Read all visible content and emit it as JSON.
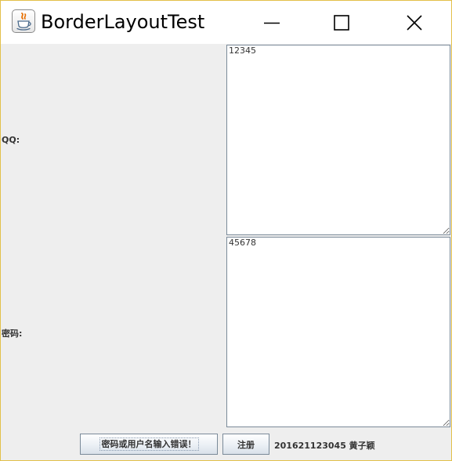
{
  "window": {
    "title": "BorderLayoutTest",
    "icon": "java-icon",
    "controls": [
      "minimize-icon",
      "maximize-icon",
      "close-icon"
    ]
  },
  "form": {
    "qq_label": "QQ:",
    "qq_value": "12345",
    "password_label": "密码:",
    "password_value": "45678"
  },
  "footer": {
    "message_button_label": "密码或用户名输入错误！",
    "register_button_label": "注册",
    "author_text": "201621123045 黄子颖"
  },
  "colors": {
    "frame_border": "#e3c04a",
    "panel_background": "#eeeeee",
    "field_border": "#7a8a99"
  }
}
